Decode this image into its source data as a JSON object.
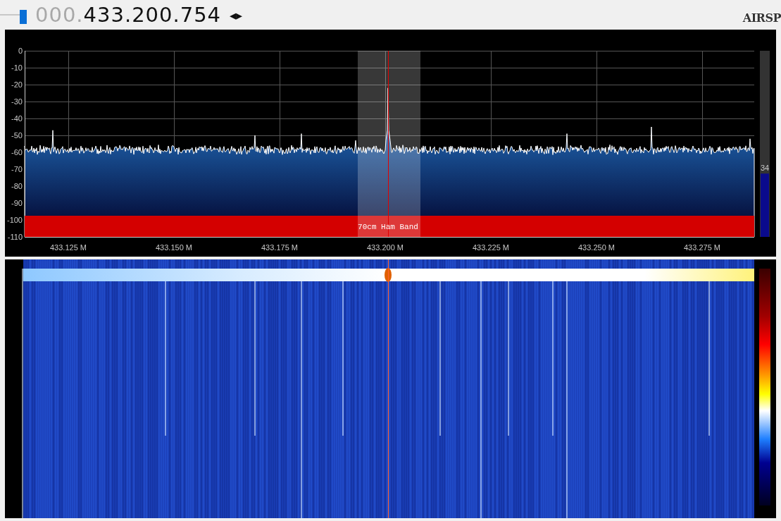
{
  "frequency": {
    "leading_zeros": "000.",
    "value": "433.200.754",
    "step_arrows": "◂▸"
  },
  "tuning_slider": {
    "level": 1
  },
  "logo": "AIRSP",
  "spectrum": {
    "y_ticks": [
      "0",
      "-10",
      "-20",
      "-30",
      "-40",
      "-50",
      "-60",
      "-70",
      "-80",
      "-90",
      "-100",
      "-110"
    ],
    "x_ticks": [
      "433.125 M",
      "433.150 M",
      "433.175 M",
      "433.200 M",
      "433.225 M",
      "433.250 M",
      "433.275 M"
    ],
    "band_plan": {
      "label": "70cm Ham Band"
    },
    "meter": {
      "level": 0.34,
      "reading": "34"
    }
  }
}
